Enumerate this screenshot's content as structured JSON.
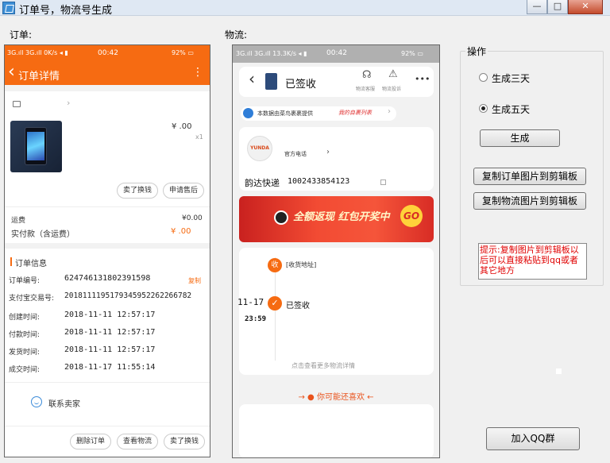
{
  "window": {
    "title": "订单号，物流号生成",
    "btn_min": "—",
    "btn_max": "□",
    "btn_close": "✕"
  },
  "labels": {
    "order": "订单:",
    "logistics": "物流:"
  },
  "left_phone": {
    "status": {
      "net": "3G.ıll 3G.ıll 0K/s ◂ ▮",
      "time": "00:42",
      "battery": "92% ▭"
    },
    "header": {
      "back": "‹",
      "title": "订单详情",
      "more": "⋮"
    },
    "item": {
      "price": "¥ .00",
      "qty": "x1"
    },
    "buttons": {
      "sell": "卖了换钱",
      "aftersale": "申请售后"
    },
    "shipping": {
      "label": "运费",
      "value": "¥0.00"
    },
    "paid": {
      "label": "实付款（含运费）",
      "value": "¥ .00"
    },
    "info": {
      "title": "订单信息",
      "copy": "复制",
      "rows": [
        {
          "label": "订单编号:",
          "value": "6247461318023915​98"
        },
        {
          "label": "支付宝交易号:",
          "value": "2018111195179345952262266782"
        },
        {
          "label": "创建时间:",
          "value": "2018-11-11 12:57:17"
        },
        {
          "label": "付款时间:",
          "value": "2018-11-11 12:57:17"
        },
        {
          "label": "发货时间:",
          "value": "2018-11-11 12:57:17"
        },
        {
          "label": "成交时间:",
          "value": "2018-11-17 11:55:14"
        }
      ]
    },
    "contact": "联系卖家",
    "bottom": {
      "delete": "删除订单",
      "view": "查看物流",
      "sell": "卖了换钱"
    }
  },
  "right_phone": {
    "status": {
      "net": "3G.ıll 3G.ıll 13.3K/s ◂ ▮",
      "time": "00:42",
      "battery": "92% ▭"
    },
    "header": {
      "back": "‹",
      "title": "已签收",
      "service": "物流客服",
      "complaint": "物流投诉",
      "more": "•••"
    },
    "banner_src": {
      "text": "本数据由菜鸟裹裹提供",
      "tag": "我的自裹列表",
      "arrow": "›"
    },
    "courier": {
      "logo": "YUNDA",
      "phone": "官方电话",
      "arrow": "›",
      "name": "韵达快递",
      "number": "1002433854123"
    },
    "promo": {
      "text": "全额返现 红包开奖中",
      "go": "GO"
    },
    "timeline": {
      "receive_badge": "收",
      "receive_text": "[收货地址]",
      "date": "11-17",
      "time": "23:59",
      "signed": "已签收",
      "more": "点击查看更多物流详情"
    },
    "maybe_like": "→ ● 你可能还喜欢 ←"
  },
  "ops": {
    "group": "操作",
    "radio3": "生成三天",
    "radio5": "生成五天",
    "selected": "生成五天",
    "generate": "生成",
    "copy_order": "复制订单图片到剪辑板",
    "copy_logistics": "复制物流图片到剪辑板",
    "hint": "提示:复制图片到剪辑板以后可以直接粘贴到qq或者其它地方",
    "join_qq": "加入QQ群"
  },
  "colors": {
    "orange": "#f66b12",
    "hint_red": "#e00000"
  }
}
